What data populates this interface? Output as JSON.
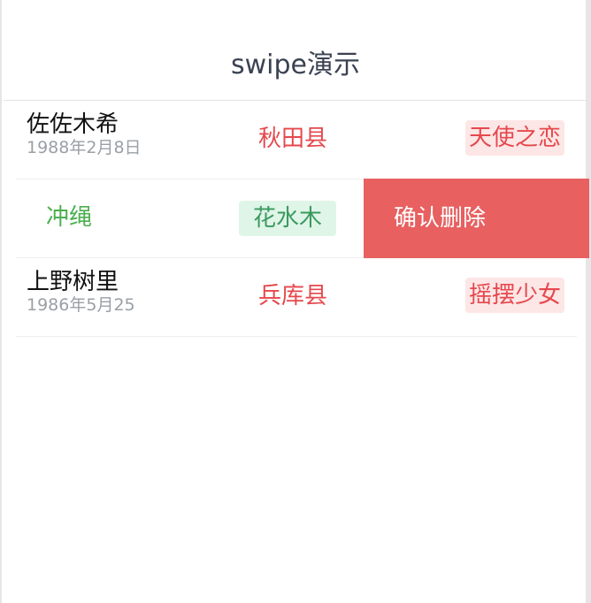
{
  "nav": {
    "title": "swipe演示"
  },
  "rows": [
    {
      "name": "佐佐木希",
      "date": "1988年2月8日",
      "city": "秋田县",
      "tag": "天使之恋"
    },
    {
      "name": "冲绳",
      "tag": "花水木",
      "action_label": "确认删除"
    },
    {
      "name": "上野树里",
      "date": "1986年5月25",
      "city": "兵库县",
      "tag": "摇摆少女"
    }
  ],
  "colors": {
    "title": "#3b4252",
    "red_text": "#e5484d",
    "red_tag_bg": "#fde6e6",
    "green_text": "#4caf50",
    "green_tag_bg": "#dff5e8",
    "delete_bg": "#e86060"
  }
}
